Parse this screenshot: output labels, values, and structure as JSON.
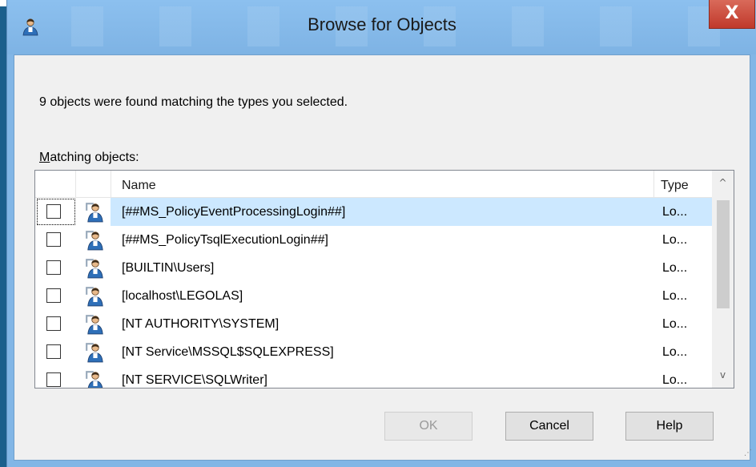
{
  "window": {
    "title": "Browse for Objects",
    "close_glyph": "X"
  },
  "status_text": "9 objects were found matching the types you selected.",
  "matching_label": {
    "accel": "M",
    "rest": "atching objects:"
  },
  "list": {
    "columns": {
      "name": "Name",
      "type": "Type"
    },
    "rows": [
      {
        "name": "[##MS_PolicyEventProcessingLogin##]",
        "type": "Lo...",
        "checked": false,
        "selected": true
      },
      {
        "name": "[##MS_PolicyTsqlExecutionLogin##]",
        "type": "Lo...",
        "checked": false,
        "selected": false
      },
      {
        "name": "[BUILTIN\\Users]",
        "type": "Lo...",
        "checked": false,
        "selected": false
      },
      {
        "name": "[localhost\\LEGOLAS]",
        "type": "Lo...",
        "checked": false,
        "selected": false
      },
      {
        "name": "[NT AUTHORITY\\SYSTEM]",
        "type": "Lo...",
        "checked": false,
        "selected": false
      },
      {
        "name": "[NT Service\\MSSQL$SQLEXPRESS]",
        "type": "Lo...",
        "checked": false,
        "selected": false
      },
      {
        "name": "[NT SERVICE\\SQLWriter]",
        "type": "Lo...",
        "checked": false,
        "selected": false
      }
    ],
    "row_icon": "user-login-icon",
    "scroll_up_glyph": "^",
    "scroll_down_glyph": "v"
  },
  "buttons": {
    "ok": "OK",
    "cancel": "Cancel",
    "help": "Help"
  },
  "colors": {
    "selection": "#cce8ff",
    "close": "#c0392b",
    "frame": "#82b6e6"
  }
}
